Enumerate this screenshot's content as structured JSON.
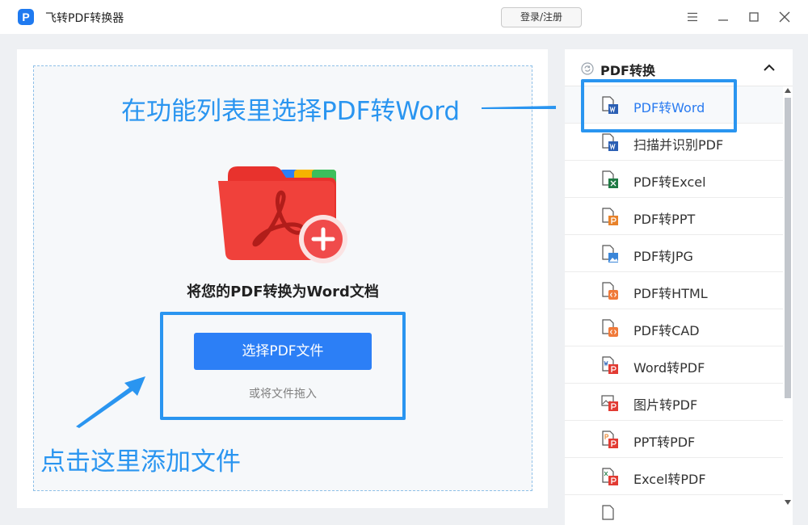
{
  "app": {
    "title": "飞转PDF转换器",
    "logo_letter": "P"
  },
  "header": {
    "login_label": "登录/注册"
  },
  "window_controls": {
    "menu_icon": "hamburger-icon",
    "minimize_icon": "minimize-icon",
    "maximize_icon": "maximize-icon",
    "close_icon": "close-icon"
  },
  "main": {
    "subtitle": "将您的PDF转换为Word文档",
    "choose_button": "选择PDF文件",
    "drag_hint": "或将文件拖入"
  },
  "annotations": {
    "top": "在功能列表里选择PDF转Word",
    "bottom": "点击这里添加文件",
    "color": "#2a95f0"
  },
  "sidebar": {
    "header": "PDF转换",
    "items": [
      {
        "label": "PDF转Word",
        "icon": "pdf-to-word-icon",
        "active": true
      },
      {
        "label": "扫描并识别PDF",
        "icon": "scan-pdf-icon",
        "active": false
      },
      {
        "label": "PDF转Excel",
        "icon": "pdf-to-excel-icon",
        "active": false
      },
      {
        "label": "PDF转PPT",
        "icon": "pdf-to-ppt-icon",
        "active": false
      },
      {
        "label": "PDF转JPG",
        "icon": "pdf-to-jpg-icon",
        "active": false
      },
      {
        "label": "PDF转HTML",
        "icon": "pdf-to-html-icon",
        "active": false
      },
      {
        "label": "PDF转CAD",
        "icon": "pdf-to-cad-icon",
        "active": false
      },
      {
        "label": "Word转PDF",
        "icon": "word-to-pdf-icon",
        "active": false
      },
      {
        "label": "图片转PDF",
        "icon": "image-to-pdf-icon",
        "active": false
      },
      {
        "label": "PPT转PDF",
        "icon": "ppt-to-pdf-icon",
        "active": false
      },
      {
        "label": "Excel转PDF",
        "icon": "excel-to-pdf-icon",
        "active": false
      }
    ]
  },
  "colors": {
    "accent": "#2c7ff6",
    "active_text": "#2a7bf0",
    "background": "#eef0f3"
  }
}
